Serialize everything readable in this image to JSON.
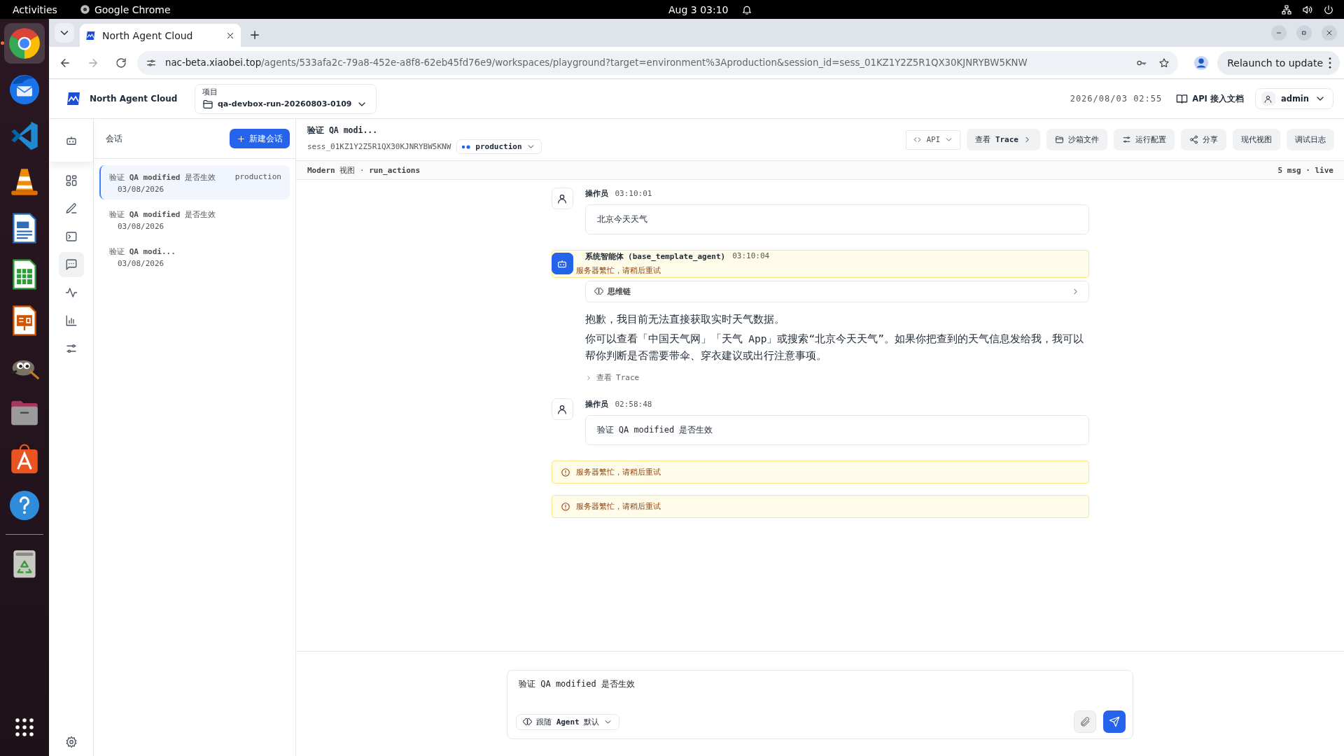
{
  "os_bar": {
    "activities": "Activities",
    "app_name": "Google Chrome",
    "clock": "Aug 3  03:10"
  },
  "dock": {
    "apps": [
      {
        "kind": "chrome",
        "selected": true
      },
      {
        "kind": "thunderbird",
        "selected": false
      },
      {
        "kind": "vscode",
        "selected": false
      },
      {
        "kind": "vlc",
        "selected": false
      },
      {
        "kind": "writer",
        "selected": false
      },
      {
        "kind": "calc",
        "selected": false
      },
      {
        "kind": "impress",
        "selected": false
      },
      {
        "kind": "gimp",
        "selected": false
      },
      {
        "kind": "files",
        "selected": false
      },
      {
        "kind": "appcenter",
        "selected": false
      },
      {
        "kind": "help",
        "selected": false
      },
      {
        "kind": "trash",
        "selected": false
      }
    ]
  },
  "browser": {
    "tab_title": "North Agent Cloud",
    "url_host": "nac-beta.xiaobei.top",
    "url_path": "/agents/533afa2c-79a8-452e-a8f8-62eb45fd76e9/workspaces/playground?target=environment%3Aproduction&session_id=sess_01KZ1Y2Z5R1QX30KJNRYBW5KNW",
    "update_button": "Relaunch to update"
  },
  "header": {
    "brand": "North Agent Cloud",
    "project_label": "项目",
    "project": "qa-devbox-run-20260803-0109",
    "datetime": "2026/08/03 02:55",
    "docs_link": "API 接入文档",
    "user": "admin"
  },
  "rail": {
    "items": [
      {
        "kind": "robot",
        "selected": false
      },
      {
        "kind": "dashboard",
        "selected": false
      },
      {
        "kind": "pencil",
        "selected": false
      },
      {
        "kind": "terminal",
        "selected": false
      },
      {
        "kind": "chat",
        "selected": true
      },
      {
        "kind": "activity",
        "selected": false
      },
      {
        "kind": "chart",
        "selected": false
      },
      {
        "kind": "sliders",
        "selected": false
      },
      {
        "kind": "settings",
        "selected": false
      }
    ]
  },
  "sessions": {
    "title": "会话",
    "new_button": "新建会话",
    "items": [
      {
        "title": "验证 **QA modified** 是否生效",
        "env": "production",
        "date": "03/08/2026",
        "selected": true
      },
      {
        "title": "验证 **QA modified** 是否生效",
        "date": "03/08/2026",
        "selected": false
      },
      {
        "title": "验证 **QA modi...**",
        "date": "03/08/2026",
        "selected": false
      }
    ]
  },
  "conversation": {
    "title": "验证 QA modi...",
    "session_id": "sess_01KZ1Y2Z5R1QX30KJNRYBW5KNW",
    "environment": "production",
    "actions": [
      {
        "kind": "api",
        "label": "API"
      },
      {
        "kind": "trace",
        "label": "查看 **Trace**"
      },
      {
        "kind": "files",
        "label": "沙箱文件"
      },
      {
        "kind": "config",
        "label": "运行配置"
      },
      {
        "kind": "share",
        "label": "分享"
      },
      {
        "kind": "plain",
        "label": "现代视图"
      },
      {
        "kind": "plain",
        "label": "调试日志"
      }
    ],
    "view_info": "**Modern** 视图 · **run_actions**",
    "stats": "5 msg · live"
  },
  "messages": [
    {
      "kind": "user",
      "author": "操作员",
      "time": "03:10:01",
      "text": "北京今天天气"
    },
    {
      "kind": "agent",
      "author": "系统智能体 (base_template_agent)",
      "time": "03:10:04",
      "banner": "服务器繁忙，请稍后重试",
      "thought": "思维链",
      "paragraphs": [
        "抱歉，我目前无法直接获取实时天气数据。",
        "你可以查看「中国天气网」「天气 App」或搜索“北京今天天气”。如果你把查到的天气信息发给我，我可以帮你判断是否需要带伞、穿衣建议或出行注意事项。"
      ],
      "trace_link": "查看 Trace"
    },
    {
      "kind": "user",
      "author": "操作员",
      "time": "02:58:48",
      "text": "验证 QA modified 是否生效"
    },
    {
      "kind": "error",
      "text": "服务器繁忙，请稍后重试"
    },
    {
      "kind": "error",
      "text": "服务器繁忙，请稍后重试"
    }
  ],
  "composer": {
    "value": "验证 QA modified 是否生效",
    "mode": "跟随 **Agent** 默认"
  }
}
